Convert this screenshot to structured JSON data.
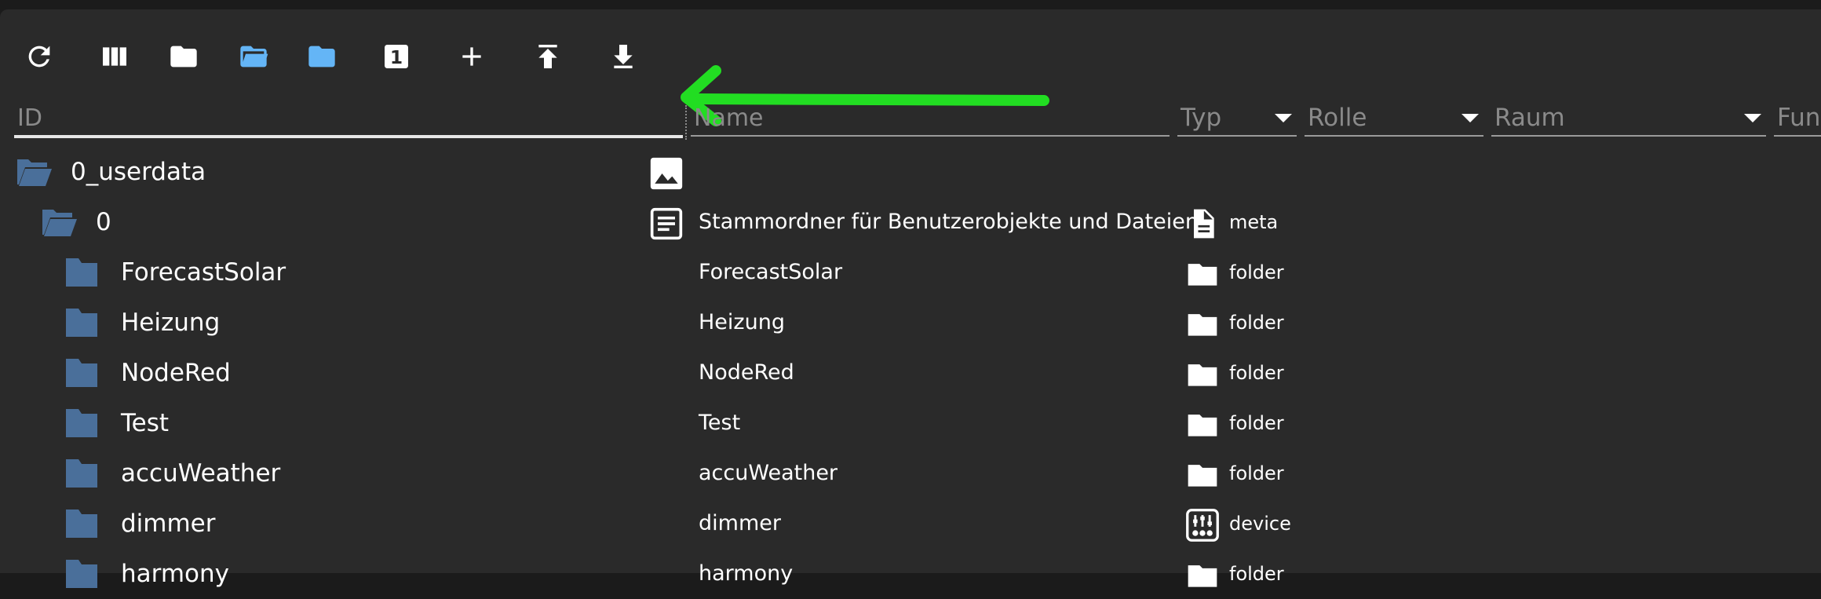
{
  "toolbar": {
    "buttons": [
      {
        "name": "refresh-button",
        "icon": "refresh-icon"
      },
      {
        "name": "columns-button",
        "icon": "columns-icon"
      },
      {
        "name": "collapse-folders-button",
        "icon": "folder-icon"
      },
      {
        "name": "expand-folders-button",
        "icon": "folder-open-icon"
      },
      {
        "name": "toggle-expert-button",
        "icon": "folder-icon"
      },
      {
        "name": "level-one-button",
        "icon": "one-box-icon",
        "text": "1"
      },
      {
        "name": "add-object-button",
        "icon": "plus-icon"
      },
      {
        "name": "upload-button",
        "icon": "upload-icon"
      },
      {
        "name": "download-button",
        "icon": "download-icon"
      }
    ]
  },
  "header": {
    "id_placeholder": "ID",
    "name_placeholder": "Name",
    "typ_label": "Typ",
    "rolle_label": "Rolle",
    "raum_label": "Raum",
    "funk_label": "Funk"
  },
  "colors": {
    "panel": "#2a2a2a",
    "background": "#1b1b1b",
    "folder": "#4a6f9a",
    "folder_active": "#64b5f6",
    "arrow": "#22dd22"
  },
  "rows": [
    {
      "id": "0_userdata",
      "name": "",
      "type": "",
      "type_icon": "",
      "id_icon": "folder-open-icon",
      "name_icon": "image-icon"
    },
    {
      "id": "0",
      "name": "Stammordner für Benutzerobjekte und Dateien",
      "type": "meta",
      "type_icon": "file-icon",
      "id_icon": "folder-open-icon",
      "name_icon": "description-icon"
    },
    {
      "id": "ForecastSolar",
      "name": "ForecastSolar",
      "type": "folder",
      "type_icon": "folder-icon",
      "id_icon": "folder-icon",
      "name_icon": ""
    },
    {
      "id": "Heizung",
      "name": "Heizung",
      "type": "folder",
      "type_icon": "folder-icon",
      "id_icon": "folder-icon",
      "name_icon": ""
    },
    {
      "id": "NodeRed",
      "name": "NodeRed",
      "type": "folder",
      "type_icon": "folder-icon",
      "id_icon": "folder-icon",
      "name_icon": ""
    },
    {
      "id": "Test",
      "name": "Test",
      "type": "folder",
      "type_icon": "folder-icon",
      "id_icon": "folder-icon",
      "name_icon": ""
    },
    {
      "id": "accuWeather",
      "name": "accuWeather",
      "type": "folder",
      "type_icon": "folder-icon",
      "id_icon": "folder-icon",
      "name_icon": ""
    },
    {
      "id": "dimmer",
      "name": "dimmer",
      "type": "device",
      "type_icon": "device-icon",
      "id_icon": "folder-icon",
      "name_icon": ""
    },
    {
      "id": "harmony",
      "name": "harmony",
      "type": "folder",
      "type_icon": "folder-icon",
      "id_icon": "folder-icon",
      "name_icon": ""
    }
  ]
}
